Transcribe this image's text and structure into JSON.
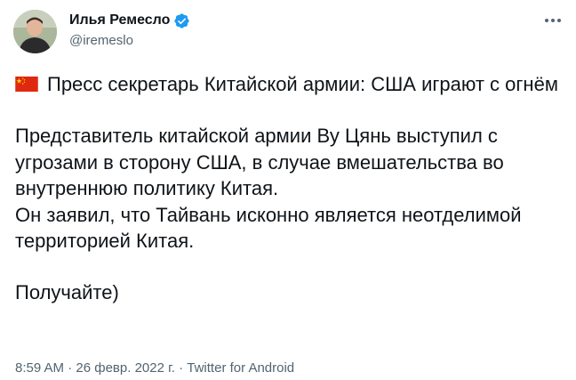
{
  "author": {
    "name": "Илья Ремесло",
    "handle": "@iremeslo"
  },
  "icons": {
    "avatar": "avatar",
    "verified": "verified-badge-icon",
    "more": "more-options-icon",
    "flag": "china-flag-icon"
  },
  "colors": {
    "verified": "#1d9bf0",
    "text": "#0f1419",
    "muted": "#536471",
    "flag_red": "#de2910",
    "flag_star": "#ffde00"
  },
  "tweet": {
    "headline": "Пресс секретарь Китайской армии: США играют с огнём",
    "paragraph1_line1": "Представитель китайской армии Ву Цянь выступил с угрозами в сторону США, в случае вмешательства во внутреннюю политику Китая.",
    "paragraph1_line2": "Он заявил, что Тайвань исконно является неотделимой территорией Китая.",
    "closing": "Получайте)"
  },
  "meta": {
    "time": "8:59 AM",
    "date": "26 февр. 2022 г.",
    "source": "Twitter for Android",
    "separator": " · "
  }
}
